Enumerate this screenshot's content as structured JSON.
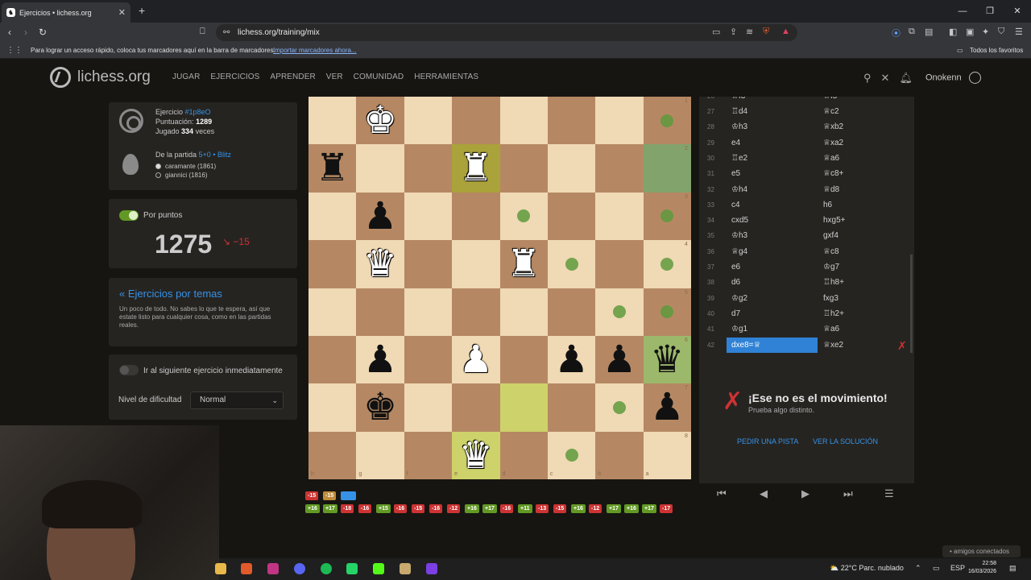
{
  "browser": {
    "tab_title": "Ejercicios • lichess.org",
    "url": "lichess.org/training/mix",
    "bookmarks_msg": "Para lograr un acceso rápido, coloca tus marcadores aquí en la barra de marcadores.",
    "bookmarks_link": "Importar marcadores ahora...",
    "favorites": "Todos los favoritos"
  },
  "site": {
    "logo": "lichess.org",
    "nav": [
      "JUGAR",
      "EJERCICIOS",
      "APRENDER",
      "VER",
      "COMUNIDAD",
      "HERRAMIENTAS"
    ],
    "username": "Onokenn"
  },
  "puzzle": {
    "label": "Ejercicio",
    "id": "#1p8eO",
    "rating_label": "Puntuación:",
    "rating": "1289",
    "played_label": "Jugado",
    "played": "334",
    "played_suffix": "veces",
    "game_label": "De la partida",
    "game": "5+0 • Blitz",
    "white": "caramante (1861)",
    "black": "giannici (1816)"
  },
  "points": {
    "label": "Por puntos",
    "rating": "1275",
    "delta": "−15"
  },
  "themes": {
    "link": "« Ejercicios por temas",
    "desc": "Un poco de todo. No sabes lo que te espera, así que estate listo para cualquier cosa, como en las partidas reales."
  },
  "settings": {
    "next_label": "Ir al siguiente ejercicio inmediatamente",
    "difficulty_label": "Nivel de dificultad",
    "difficulty_value": "Normal"
  },
  "board": {
    "files": [
      "h",
      "g",
      "f",
      "e",
      "d",
      "c",
      "b",
      "a"
    ],
    "ranks": [
      "1",
      "2",
      "3",
      "4",
      "5",
      "6",
      "7",
      "8"
    ]
  },
  "moves": [
    {
      "n": "27",
      "w": "♖d4",
      "b": "♕c2"
    },
    {
      "n": "28",
      "w": "♔h3",
      "b": "♕xb2"
    },
    {
      "n": "29",
      "w": "e4",
      "b": "♕xa2"
    },
    {
      "n": "30",
      "w": "♖e2",
      "b": "♕a6"
    },
    {
      "n": "31",
      "w": "e5",
      "b": "♕c8+"
    },
    {
      "n": "32",
      "w": "♔h4",
      "b": "♕d8"
    },
    {
      "n": "33",
      "w": "c4",
      "b": "h6"
    },
    {
      "n": "34",
      "w": "cxd5",
      "b": "hxg5+"
    },
    {
      "n": "35",
      "w": "♔h3",
      "b": "gxf4"
    },
    {
      "n": "36",
      "w": "♕g4",
      "b": "♕c8"
    },
    {
      "n": "37",
      "w": "e6",
      "b": "♔g7"
    },
    {
      "n": "38",
      "w": "d6",
      "b": "♖h8+"
    },
    {
      "n": "39",
      "w": "♔g2",
      "b": "fxg3"
    },
    {
      "n": "40",
      "w": "d7",
      "b": "♖h2+"
    },
    {
      "n": "41",
      "w": "♔g1",
      "b": "♕a6"
    },
    {
      "n": "42",
      "w": "dxe8=♕",
      "b": "♕xe2"
    }
  ],
  "feedback": {
    "title": "¡Ese no es el movimiento!",
    "subtitle": "Prueba algo distinto.",
    "hint": "PEDIR UNA PISTA",
    "solution": "VER LA SOLUCIÓN"
  },
  "history_row1": [
    "-15",
    "-15"
  ],
  "history_row2": [
    "+16",
    "+17",
    "-18",
    "-16",
    "+15",
    "-16",
    "-15",
    "-16",
    "-12",
    "+16",
    "+17",
    "-16",
    "+11",
    "-13",
    "-15",
    "+16",
    "-12",
    "+17",
    "+16",
    "+17",
    "-17"
  ],
  "taskbar": {
    "weather": "22°C  Parc. nublado",
    "lang": "ESP",
    "time": "22:58",
    "date": "16/03/2026",
    "friends": "amigos conectados"
  },
  "colors": {
    "accent": "#3692e7",
    "error": "#cc3333",
    "success": "#629924"
  }
}
